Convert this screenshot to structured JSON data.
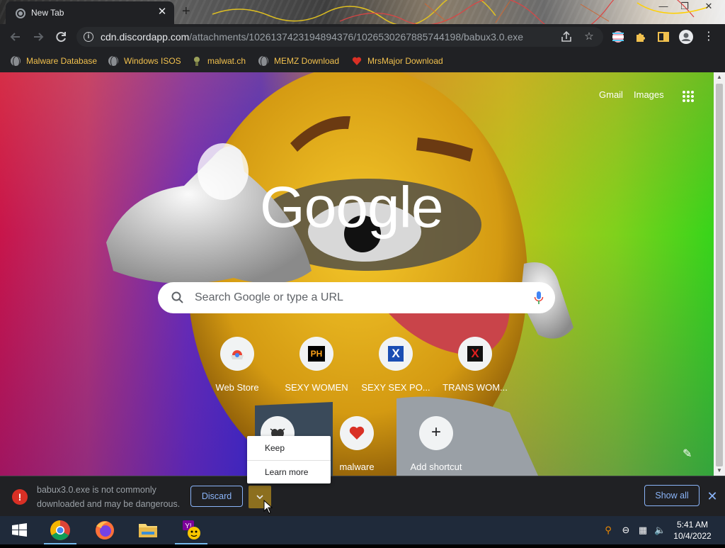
{
  "browser": {
    "tab": {
      "title": "New Tab",
      "close": "✕"
    },
    "new_tab": "+",
    "window_controls": {
      "minimize": "—",
      "restore": "❐",
      "close": "✕"
    },
    "url": {
      "host": "cdn.discordapp.com",
      "path": "/attachments/1026137423194894376/1026530267885744198/babux3.0.exe"
    },
    "bookmarks": [
      {
        "label": "Malware Database",
        "icon": "globe-icon"
      },
      {
        "label": "Windows ISOS",
        "icon": "globe-icon"
      },
      {
        "label": "malwat.ch",
        "icon": "pin-icon"
      },
      {
        "label": "MEMZ Download",
        "icon": "globe-icon"
      },
      {
        "label": "MrsMajor Download",
        "icon": "heart-icon"
      }
    ]
  },
  "newtab": {
    "links": {
      "gmail": "Gmail",
      "images": "Images"
    },
    "logo": "Google",
    "search_placeholder": "Search Google or type a URL",
    "shortcuts": [
      {
        "label": "Web Store",
        "icon": "chrome-webstore-icon"
      },
      {
        "label": "SEXY WOMEN",
        "icon": "ph-icon",
        "icon_text": "PH"
      },
      {
        "label": "SEXY SEX PO...",
        "icon": "x-site-icon",
        "icon_text": "X"
      },
      {
        "label": "TRANS WOM...",
        "icon": "x-red-icon",
        "icon_text": "X"
      },
      {
        "label": "",
        "icon": "bug-icon"
      },
      {
        "label": "malware",
        "icon": "heart-icon"
      },
      {
        "label": "Add shortcut",
        "icon": "plus-icon",
        "icon_text": "+"
      }
    ]
  },
  "menu": {
    "items": [
      "Keep",
      "Learn more"
    ]
  },
  "download": {
    "message": "babux3.0.exe is not commonly downloaded and may be dangerous.",
    "discard": "Discard",
    "show_all": "Show all",
    "close": "✕",
    "warning_icon": "!"
  },
  "taskbar": {
    "time": "5:41 AM",
    "date": "10/4/2022",
    "apps": [
      "windows-start-icon",
      "chrome-icon",
      "firefox-icon",
      "file-explorer-icon",
      "yahoo-messenger-icon"
    ]
  },
  "colors": {
    "bookmark_text": "#f2c14e",
    "accent_blue": "#8ab4f8",
    "warning_red": "#d93025"
  }
}
